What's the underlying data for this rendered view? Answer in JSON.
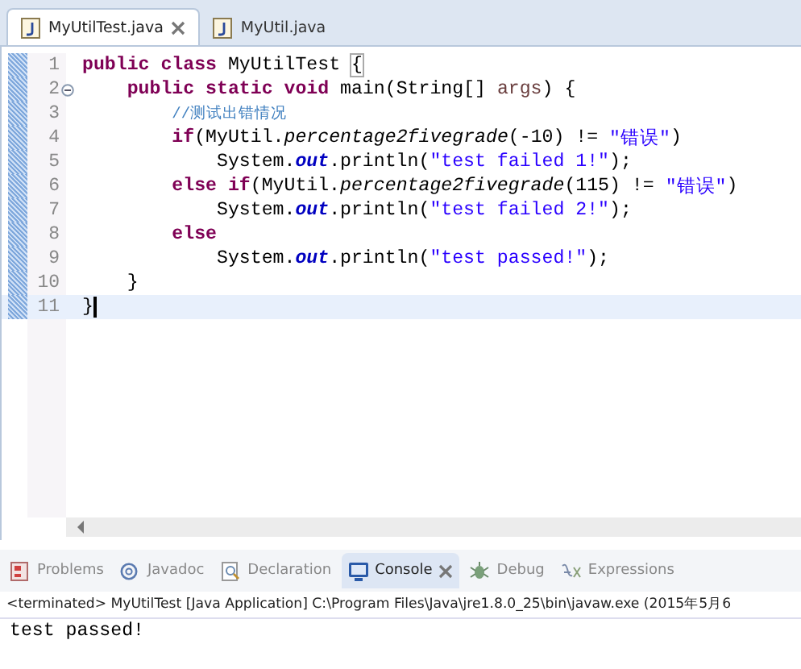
{
  "editor_tabs": [
    {
      "label": "MyUtilTest.java",
      "selected": true,
      "closable": true
    },
    {
      "label": "MyUtil.java",
      "selected": false,
      "closable": false
    }
  ],
  "code": [
    {
      "number": "1",
      "current": false,
      "foldable": false,
      "tokens": [
        {
          "kind": "keyword",
          "text": "public class "
        },
        {
          "kind": "plain",
          "text": "MyUtilTest "
        },
        {
          "kind": "match",
          "text": "{"
        }
      ],
      "children": [
        {
          "number": "2",
          "current": false,
          "foldable": true,
          "tokens": [
            {
              "kind": "keyword",
              "text": "public static void "
            },
            {
              "kind": "plain",
              "text": "main(String[] "
            },
            {
              "kind": "param",
              "text": "args"
            },
            {
              "kind": "plain",
              "text": ") {"
            }
          ],
          "children": [
            {
              "number": "3",
              "current": false,
              "foldable": false,
              "tokens": [
                {
                  "kind": "comment",
                  "text": "//测试出错情况"
                }
              ]
            },
            {
              "number": "4",
              "current": false,
              "foldable": false,
              "tokens": [
                {
                  "kind": "keyword",
                  "text": "if"
                },
                {
                  "kind": "plain",
                  "text": "(MyUtil."
                },
                {
                  "kind": "method",
                  "text": "percentage2fivegrade"
                },
                {
                  "kind": "plain",
                  "text": "(-10) != "
                },
                {
                  "kind": "string",
                  "text": "\"错误\""
                },
                {
                  "kind": "plain",
                  "text": ")"
                }
              ],
              "children": [
                {
                  "number": "5",
                  "current": false,
                  "foldable": false,
                  "tokens": [
                    {
                      "kind": "plain",
                      "text": "System."
                    },
                    {
                      "kind": "field",
                      "text": "out"
                    },
                    {
                      "kind": "plain",
                      "text": ".println("
                    },
                    {
                      "kind": "string",
                      "text": "\"test failed 1!\""
                    },
                    {
                      "kind": "plain",
                      "text": ");"
                    }
                  ]
                }
              ]
            },
            {
              "number": "6",
              "current": false,
              "foldable": false,
              "tokens": [
                {
                  "kind": "keyword",
                  "text": "else if"
                },
                {
                  "kind": "plain",
                  "text": "(MyUtil."
                },
                {
                  "kind": "method",
                  "text": "percentage2fivegrade"
                },
                {
                  "kind": "plain",
                  "text": "(115) != "
                },
                {
                  "kind": "string",
                  "text": "\"错误\""
                },
                {
                  "kind": "plain",
                  "text": ")"
                }
              ],
              "children": [
                {
                  "number": "7",
                  "current": false,
                  "foldable": false,
                  "tokens": [
                    {
                      "kind": "plain",
                      "text": "System."
                    },
                    {
                      "kind": "field",
                      "text": "out"
                    },
                    {
                      "kind": "plain",
                      "text": ".println("
                    },
                    {
                      "kind": "string",
                      "text": "\"test failed 2!\""
                    },
                    {
                      "kind": "plain",
                      "text": ");"
                    }
                  ]
                }
              ]
            },
            {
              "number": "8",
              "current": false,
              "foldable": false,
              "tokens": [
                {
                  "kind": "keyword",
                  "text": "else"
                }
              ],
              "children": [
                {
                  "number": "9",
                  "current": false,
                  "foldable": false,
                  "tokens": [
                    {
                      "kind": "plain",
                      "text": "System."
                    },
                    {
                      "kind": "field",
                      "text": "out"
                    },
                    {
                      "kind": "plain",
                      "text": ".println("
                    },
                    {
                      "kind": "string",
                      "text": "\"test passed!\""
                    },
                    {
                      "kind": "plain",
                      "text": ");"
                    }
                  ]
                }
              ]
            }
          ]
        },
        {
          "number": "10",
          "current": false,
          "foldable": false,
          "tokens": [
            {
              "kind": "plain",
              "text": "}"
            }
          ]
        }
      ]
    },
    {
      "number": "11",
      "current": true,
      "foldable": false,
      "tokens": [
        {
          "kind": "plain",
          "text": "}"
        }
      ]
    }
  ],
  "view_tabs": [
    {
      "label": "Problems",
      "kind": "problems",
      "selected": false,
      "closable": false
    },
    {
      "label": "Javadoc",
      "kind": "javadoc",
      "selected": false,
      "closable": false
    },
    {
      "label": "Declaration",
      "kind": "declaration",
      "selected": false,
      "closable": false
    },
    {
      "label": "Console",
      "kind": "console",
      "selected": true,
      "closable": true
    },
    {
      "label": "Debug",
      "kind": "debug",
      "selected": false,
      "closable": false
    },
    {
      "label": "Expressions",
      "kind": "expressions",
      "selected": false,
      "closable": false
    }
  ],
  "console": {
    "header": "<terminated> MyUtilTest [Java Application] C:\\Program Files\\Java\\jre1.8.0_25\\bin\\javaw.exe (2015年5月6",
    "output": "test passed!"
  }
}
